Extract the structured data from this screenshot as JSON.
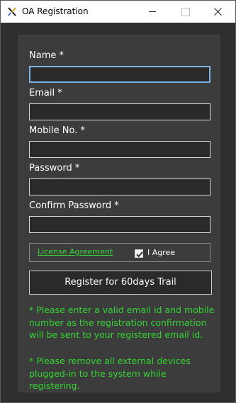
{
  "window": {
    "title": "OA Registration",
    "colors": {
      "background": "#2f2f2f",
      "panel": "#3c3c3c",
      "accent_green": "#33d433",
      "focus_border": "#7ab3e6"
    }
  },
  "form": {
    "name_label": "Name *",
    "name_value": "",
    "email_label": "Email *",
    "email_value": "",
    "mobile_label": "Mobile No. *",
    "mobile_value": "",
    "password_label": "Password *",
    "password_value": "",
    "confirm_label": "Confirm Password *",
    "confirm_value": "",
    "license_link": "License Agreement",
    "agree_label": "I Agree",
    "agree_checked": true,
    "register_button": "Register for 60days Trail"
  },
  "notes": {
    "note1": "* Please enter a valid email id and mobile number as the registration confirmation will be sent to your registered email id.",
    "note2": "* Please remove all external devices plugged-in to the system while registering."
  },
  "icons": {
    "app": "app-logo-icon",
    "minimize": "minimize-icon",
    "maximize": "maximize-icon",
    "close": "close-icon",
    "check": "checkmark-icon"
  }
}
